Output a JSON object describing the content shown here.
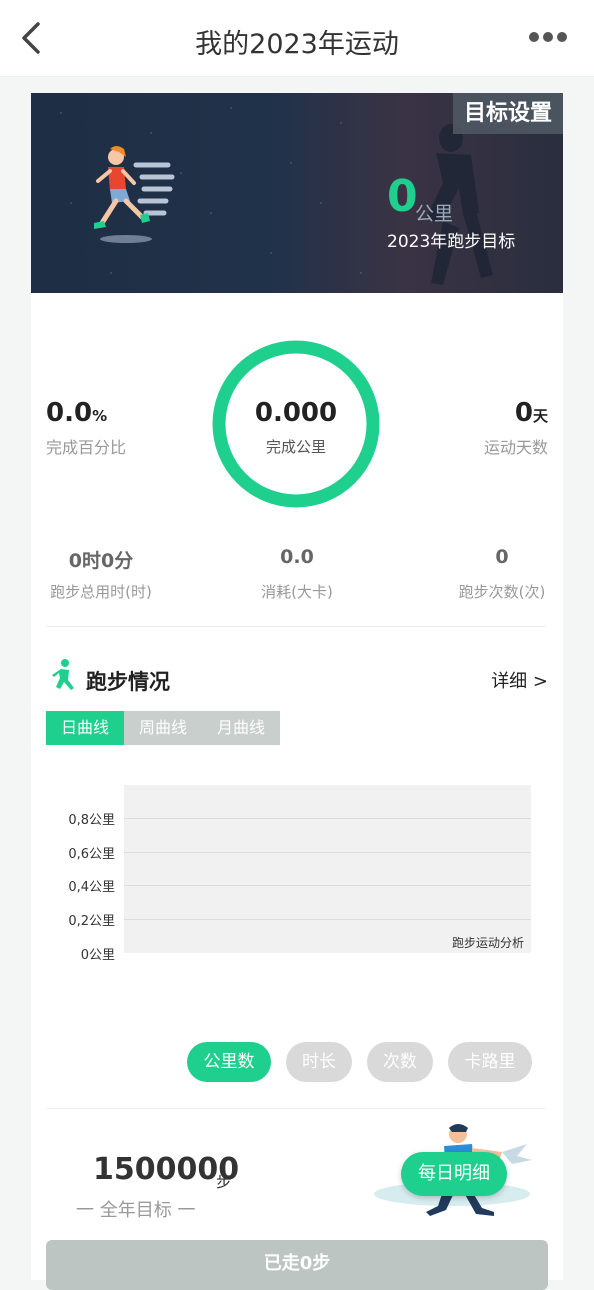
{
  "nav": {
    "title": "我的2023年运动",
    "back_icon": "chevron-left-icon",
    "more_icon": "more-dots-icon"
  },
  "hero": {
    "settings_button": "目标设置",
    "distance_value": "0",
    "distance_unit": "公里",
    "goal_label": "2023年跑步目标"
  },
  "summary": {
    "completion_value": "0.0",
    "completion_unit": "%",
    "completion_label": "完成百分比",
    "distance_value": "0.000",
    "distance_label": "完成公里",
    "progress_fraction": 0.0,
    "days_value": "0",
    "days_unit": "天",
    "days_label": "运动天数"
  },
  "stats": [
    {
      "value": "0时0分",
      "label": "跑步总用时(时)"
    },
    {
      "value": "0.0",
      "label": "消耗(大卡)"
    },
    {
      "value": "0",
      "label": "跑步次数(次)"
    }
  ],
  "running": {
    "icon": "runner-icon",
    "title": "跑步情况",
    "detail_link": "详细 >",
    "tabs": [
      "日曲线",
      "周曲线",
      "月曲线"
    ],
    "active_tab": 0,
    "metrics": [
      "公里数",
      "时长",
      "次数",
      "卡路里"
    ],
    "active_metric": 0
  },
  "chart_data": {
    "type": "line",
    "y_ticks": [
      "0,8公里",
      "0,6公里",
      "0,4公里",
      "0,2公里",
      "0公里"
    ],
    "ylim": [
      0,
      0.8
    ],
    "annotation": "跑步运动分析",
    "series": []
  },
  "steps": {
    "goal_value": "1500000",
    "goal_unit": "步",
    "goal_label": "一 全年目标 一",
    "daily_button": "每日明细",
    "walked_button": "已走0步"
  },
  "colors": {
    "accent": "#1ecf8e",
    "tab_inactive": "#c9cfcd",
    "pill_inactive": "#d9d9d9",
    "bottom_button": "#bcc5c2"
  }
}
